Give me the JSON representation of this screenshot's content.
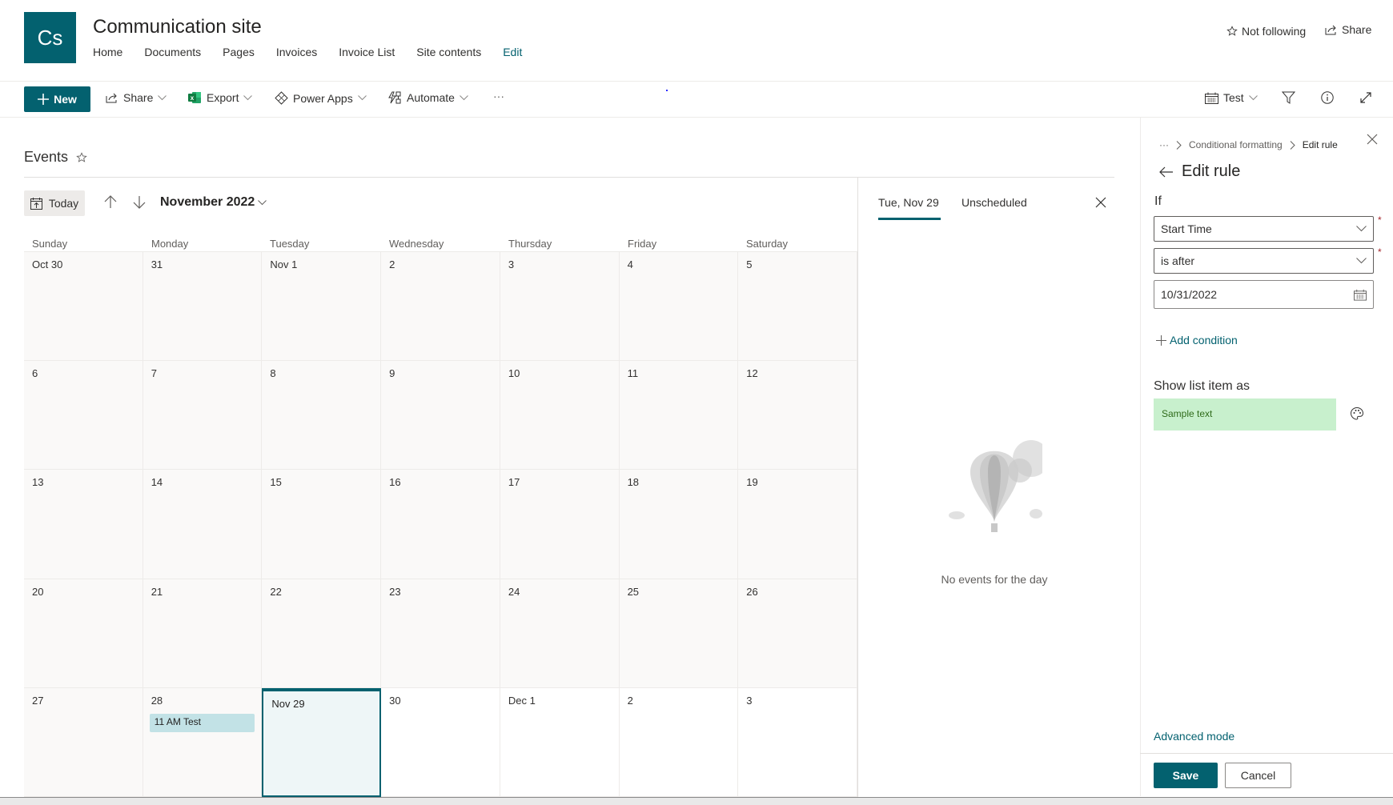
{
  "site": {
    "logo_initials": "Cs",
    "title": "Communication site",
    "nav": [
      "Home",
      "Documents",
      "Pages",
      "Invoices",
      "Invoice List",
      "Site contents",
      "Edit"
    ],
    "follow_label": "Not following",
    "share_label": "Share"
  },
  "commandbar": {
    "new_label": "New",
    "share_label": "Share",
    "export_label": "Export",
    "powerapps_label": "Power Apps",
    "automate_label": "Automate",
    "more_label": "···",
    "view_label": "Test"
  },
  "list": {
    "title": "Events",
    "today_label": "Today",
    "month_label": "November 2022",
    "weekdays": [
      "Sunday",
      "Monday",
      "Tuesday",
      "Wednesday",
      "Thursday",
      "Friday",
      "Saturday"
    ],
    "days": [
      "Oct 30",
      "31",
      "Nov 1",
      "2",
      "3",
      "4",
      "5",
      "6",
      "7",
      "8",
      "9",
      "10",
      "11",
      "12",
      "13",
      "14",
      "15",
      "16",
      "17",
      "18",
      "19",
      "20",
      "21",
      "22",
      "23",
      "24",
      "25",
      "26",
      "27",
      "28",
      "Nov 29",
      "30",
      "Dec 1",
      "2",
      "3"
    ],
    "today_index": 30,
    "event": {
      "day_index": 29,
      "label": "11 AM Test"
    }
  },
  "daypane": {
    "tab_selected": "Tue, Nov 29",
    "tab_other": "Unscheduled",
    "empty_text": "No events for the day"
  },
  "panel": {
    "breadcrumb_more": "···",
    "breadcrumb_parent": "Conditional formatting",
    "breadcrumb_current": "Edit rule",
    "title": "Edit rule",
    "if_label": "If",
    "field_column": "Start Time",
    "field_operator": "is after",
    "field_value": "10/31/2022",
    "required_mark": "*",
    "add_condition": "Add condition",
    "show_as_label": "Show list item as",
    "sample_text": "Sample text",
    "advanced_mode": "Advanced mode",
    "save_label": "Save",
    "cancel_label": "Cancel"
  },
  "colors": {
    "brand": "#03616f",
    "event_chip": "#c2e2e6",
    "sample_bg": "#c8f0cd",
    "sample_fg": "#2f6b1a",
    "past_cell": "#faf9f8",
    "today_cell": "#eef6f7"
  }
}
